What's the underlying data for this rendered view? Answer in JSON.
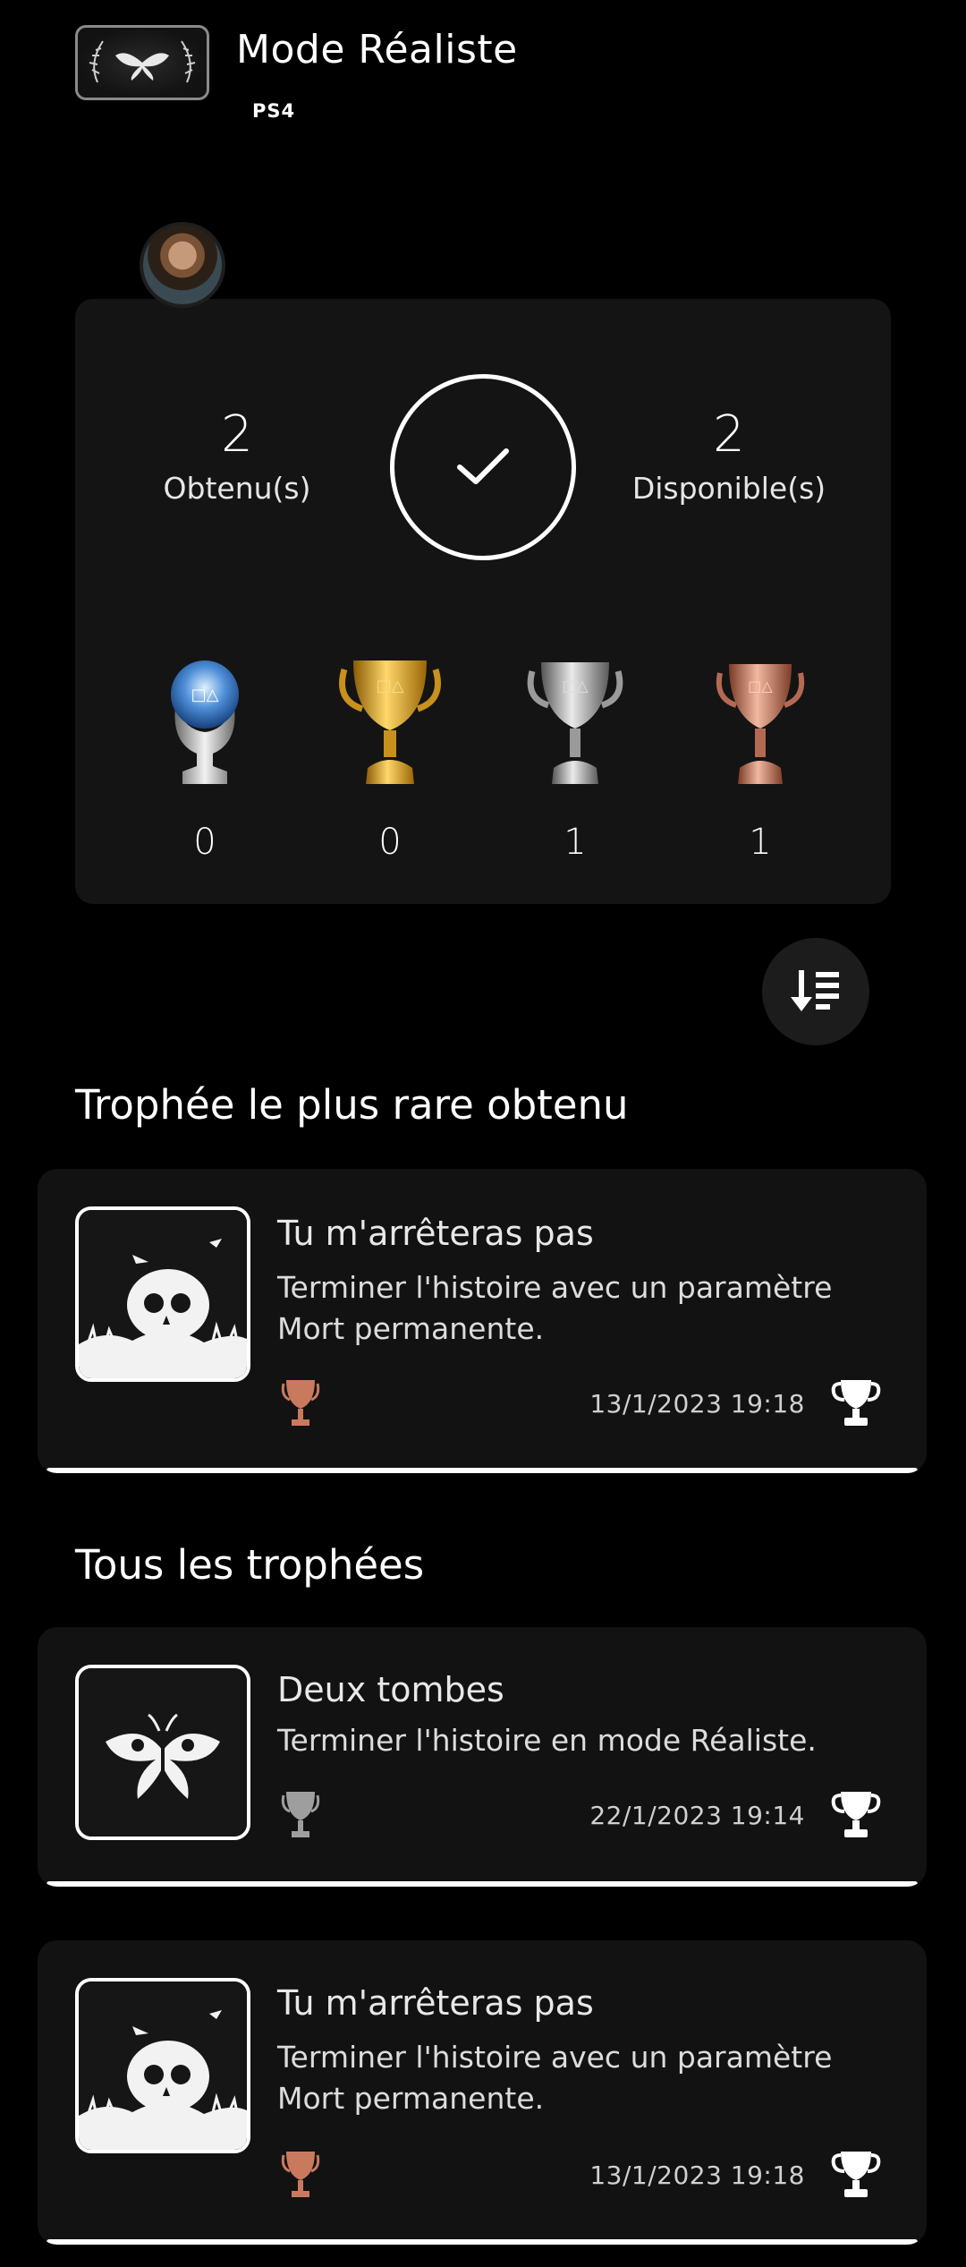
{
  "game": {
    "title": "Mode Réaliste",
    "platform": "PS4"
  },
  "summary": {
    "earned_count": "2",
    "earned_label": "Obtenu(s)",
    "available_count": "2",
    "available_label": "Disponible(s)",
    "grades": [
      {
        "name": "platinum",
        "count": "0",
        "color": "#8fc7ff"
      },
      {
        "name": "gold",
        "count": "0",
        "color": "#d4a017"
      },
      {
        "name": "silver",
        "count": "1",
        "color": "#bdbdbd"
      },
      {
        "name": "bronze",
        "count": "1",
        "color": "#c97a5e"
      }
    ]
  },
  "sort_icon": "sort-descending-icon",
  "rarest": {
    "section_title": "Trophée le plus rare obtenu",
    "trophy": {
      "name": "Tu m'arrêteras pas",
      "description": "Terminer l'histoire avec un paramètre Mort permanente.",
      "grade": "bronze",
      "date": "13/1/2023",
      "time": "19:18",
      "date_time": "13/1/2023  19:18",
      "image_icon": "skull-icon"
    }
  },
  "all": {
    "section_title": "Tous les trophées",
    "trophies": [
      {
        "name": "Deux tombes",
        "description": "Terminer l'histoire en mode Réaliste.",
        "grade": "silver",
        "date_time": "22/1/2023  19:14",
        "image_icon": "moth-icon"
      },
      {
        "name": "Tu m'arrêteras pas",
        "description": "Terminer l'histoire avec un paramètre Mort permanente.",
        "grade": "bronze",
        "date_time": "13/1/2023  19:18",
        "image_icon": "skull-icon"
      }
    ]
  }
}
